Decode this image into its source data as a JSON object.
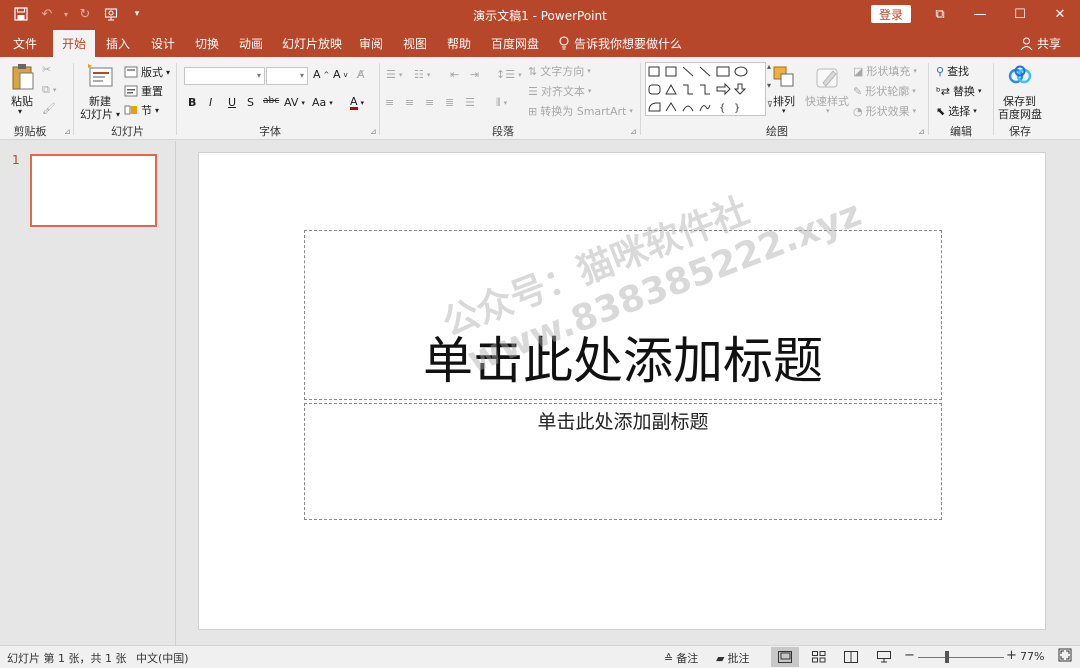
{
  "window": {
    "title": "演示文稿1  -  PowerPoint",
    "login_label": "登录",
    "restore_glyph": "⧉",
    "minimize_glyph": "—",
    "maximize_glyph": "☐",
    "close_glyph": "✕"
  },
  "tabs": {
    "file": "文件",
    "home": "开始",
    "insert": "插入",
    "design": "设计",
    "transitions": "切换",
    "animations": "动画",
    "slideshow": "幻灯片放映",
    "review": "审阅",
    "view": "视图",
    "help": "帮助",
    "baidu": "百度网盘",
    "tell_me": "告诉我你想要做什么",
    "share": "共享"
  },
  "ribbon": {
    "clipboard": {
      "paste": "粘贴",
      "label": "剪贴板"
    },
    "slides": {
      "new_slide_1": "新建",
      "new_slide_2": "幻灯片",
      "layout": "版式",
      "reset": "重置",
      "section": "节",
      "label": "幻灯片"
    },
    "font": {
      "label": "字体",
      "bold": "B",
      "italic": "I",
      "underline": "U",
      "strike": "S",
      "abc": "abc",
      "spacing": "AV",
      "case": "Aa",
      "color": "A"
    },
    "paragraph": {
      "label": "段落",
      "text_direction": "文字方向",
      "align_text": "对齐文本",
      "smartart": "转换为 SmartArt"
    },
    "drawing": {
      "label": "绘图",
      "arrange": "排列",
      "quick_styles": "快速样式",
      "shape_fill": "形状填充",
      "shape_outline": "形状轮廓",
      "shape_effects": "形状效果"
    },
    "editing": {
      "label": "编辑",
      "find": "查找",
      "replace": "替换",
      "select": "选择"
    },
    "save": {
      "label": "保存",
      "save_to_1": "保存到",
      "save_to_2": "百度网盘"
    }
  },
  "slides_pane": {
    "slide_number": "1"
  },
  "slide": {
    "title_placeholder": "单击此处添加标题",
    "subtitle_placeholder": "单击此处添加副标题"
  },
  "watermark": {
    "line1": "公众号：猫咪软件社",
    "line2": "www.838385222.xyz"
  },
  "statusbar": {
    "slide_info": "幻灯片 第 1 张，共 1 张",
    "language": "中文(中国)",
    "notes": "备注",
    "comments": "批注",
    "zoom": "77%",
    "minus": "−",
    "plus": "+"
  },
  "colors": {
    "accent": "#b7472a",
    "thumb_border": "#e0694b"
  }
}
